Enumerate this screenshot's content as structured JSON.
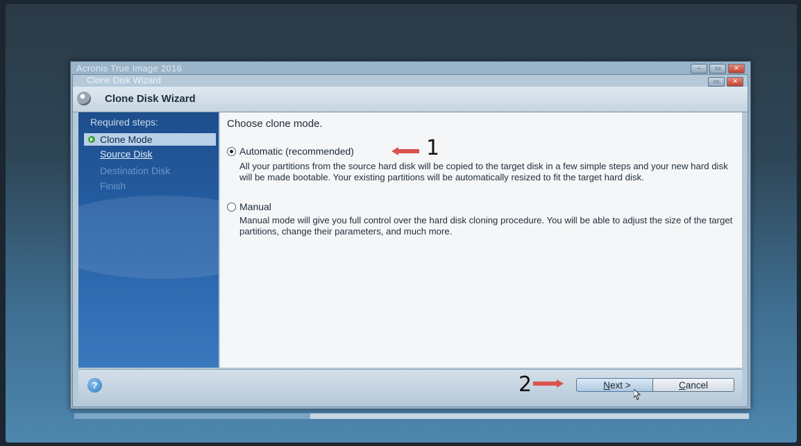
{
  "app": {
    "title": "Acronis True Image 2016"
  },
  "wizard": {
    "caption": "Clone Disk Wizard",
    "header_title": "Clone Disk Wizard"
  },
  "sidebar": {
    "heading": "Required steps:",
    "steps": [
      {
        "label": "Clone Mode",
        "state": "current"
      },
      {
        "label": "Source Disk",
        "state": "link"
      },
      {
        "label": "Destination Disk",
        "state": "disabled"
      },
      {
        "label": "Finish",
        "state": "disabled"
      }
    ]
  },
  "content": {
    "title": "Choose clone mode.",
    "options": [
      {
        "label": "Automatic (recommended)",
        "selected": true,
        "description": "All your partitions from the source hard disk will be copied to the target disk in a few simple steps and your new hard disk will be made bootable. Your existing partitions will be automatically resized to fit the target hard disk."
      },
      {
        "label": "Manual",
        "selected": false,
        "description": "Manual mode will give you full control over the hard disk cloning procedure. You will be able to adjust the size of the target partitions, change their parameters, and much more."
      }
    ]
  },
  "annotations": {
    "step1": "1",
    "step2": "2",
    "arrow_color": "#d9534f"
  },
  "footer": {
    "next_label_underlined": "N",
    "next_label_rest": "ext >",
    "cancel_label_underlined": "C",
    "cancel_label_rest": "ancel"
  },
  "icons": {
    "help": "help-icon",
    "logo": "acronis-logo-icon",
    "current_step": "green-arrow-icon"
  }
}
